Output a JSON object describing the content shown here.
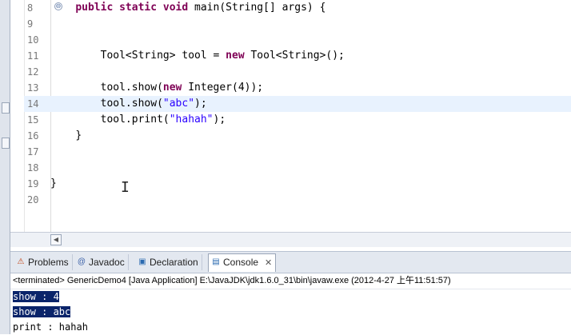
{
  "editor": {
    "lines": [
      {
        "num": "8",
        "indent": "    ",
        "tokens": [
          {
            "t": "public static void",
            "k": "kw"
          },
          {
            "t": " main(String[] args) {",
            "k": ""
          }
        ]
      },
      {
        "num": "9",
        "indent": "",
        "tokens": []
      },
      {
        "num": "10",
        "indent": "",
        "tokens": []
      },
      {
        "num": "11",
        "indent": "        ",
        "tokens": [
          {
            "t": "Tool<String> tool = ",
            "k": ""
          },
          {
            "t": "new",
            "k": "kw"
          },
          {
            "t": " Tool<String>();",
            "k": ""
          }
        ]
      },
      {
        "num": "12",
        "indent": "",
        "tokens": []
      },
      {
        "num": "13",
        "indent": "        ",
        "tokens": [
          {
            "t": "tool.show(",
            "k": ""
          },
          {
            "t": "new",
            "k": "kw"
          },
          {
            "t": " Integer(4));",
            "k": ""
          }
        ]
      },
      {
        "num": "14",
        "indent": "        ",
        "tokens": [
          {
            "t": "tool.show(",
            "k": ""
          },
          {
            "t": "\"abc\"",
            "k": "str"
          },
          {
            "t": ");",
            "k": ""
          }
        ]
      },
      {
        "num": "15",
        "indent": "        ",
        "tokens": [
          {
            "t": "tool.print(",
            "k": ""
          },
          {
            "t": "\"hahah\"",
            "k": "str"
          },
          {
            "t": ");",
            "k": ""
          }
        ]
      },
      {
        "num": "16",
        "indent": "    ",
        "tokens": [
          {
            "t": "}",
            "k": ""
          }
        ]
      },
      {
        "num": "17",
        "indent": "",
        "tokens": []
      },
      {
        "num": "18",
        "indent": "",
        "tokens": []
      },
      {
        "num": "19",
        "indent": "",
        "tokens": [
          {
            "t": "}",
            "k": ""
          }
        ]
      },
      {
        "num": "20",
        "indent": "",
        "tokens": []
      }
    ],
    "fold_marker": "⊖",
    "current_line": "14"
  },
  "tabs": [
    {
      "label": "Problems",
      "icon": "problems-icon",
      "glyph": "⚠",
      "active": false
    },
    {
      "label": "Javadoc",
      "icon": "javadoc-icon",
      "glyph": "@",
      "active": false
    },
    {
      "label": "Declaration",
      "icon": "declaration-icon",
      "glyph": "▣",
      "active": false
    },
    {
      "label": "Console",
      "icon": "console-icon",
      "glyph": "▤",
      "active": true
    }
  ],
  "console": {
    "close_glyph": "✕",
    "status": "<terminated> GenericDemo4 [Java Application] E:\\JavaJDK\\jdk1.6.0_31\\bin\\javaw.exe (2012-4-27 上午11:51:57)",
    "output": [
      {
        "text": "show : 4",
        "selected": true
      },
      {
        "text": "show : abc",
        "selected": true
      },
      {
        "text": "print : hahah",
        "selected": false
      }
    ]
  },
  "colors": {
    "keyword": "#7f0055",
    "string": "#2a00ff",
    "current_line": "#e8f2fe",
    "selection": "#0a246a"
  }
}
